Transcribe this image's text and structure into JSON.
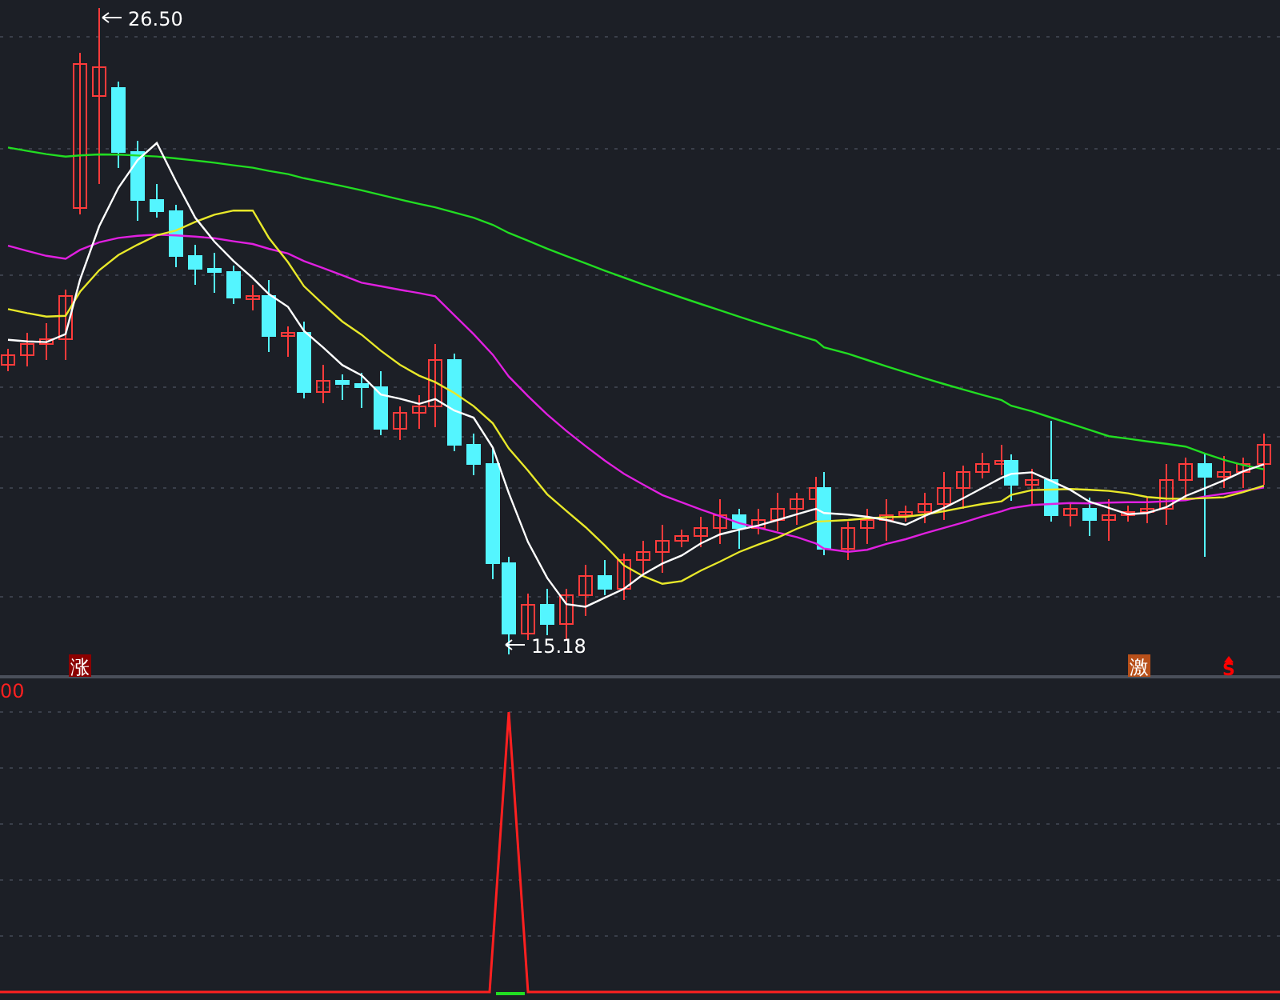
{
  "price_panel": {
    "high_label": "26.50",
    "low_label": "15.18",
    "signals": [
      {
        "kind": "box",
        "text": "涨",
        "color": "#8b0000"
      },
      {
        "kind": "box",
        "text": "激",
        "color": "#b8501a"
      },
      {
        "kind": "arrow",
        "text": "S",
        "color": "#ff0000"
      }
    ]
  },
  "indicator_panel": {
    "axis_label": "00"
  }
}
